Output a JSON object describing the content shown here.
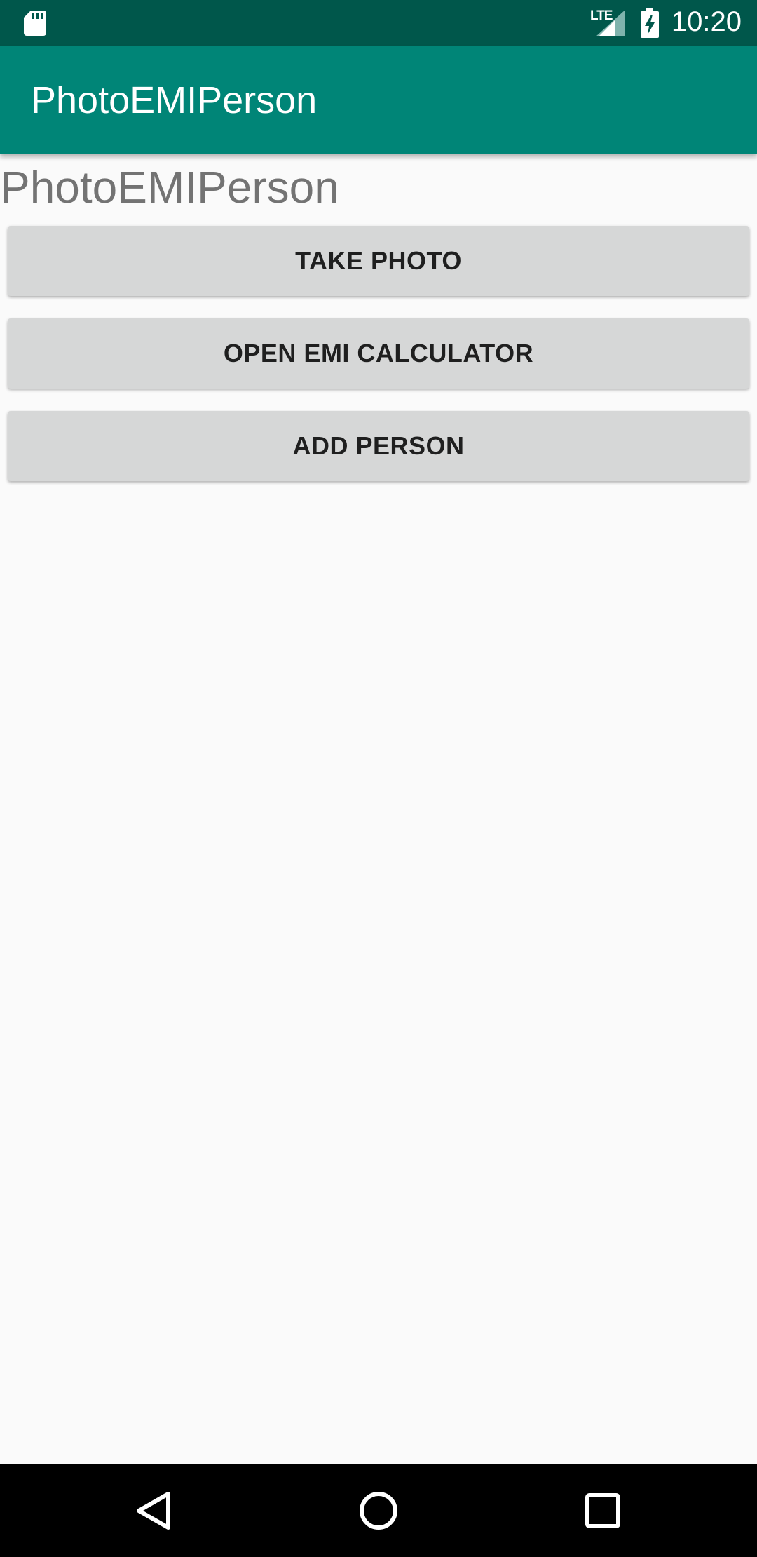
{
  "status_bar": {
    "network_label": "LTE",
    "time": "10:20",
    "icons": [
      "sd-card-icon",
      "signal-icon",
      "battery-charging-icon"
    ]
  },
  "app_bar": {
    "title": "PhotoEMIPerson"
  },
  "main": {
    "heading": "PhotoEMIPerson",
    "buttons": [
      {
        "label": "TAKE PHOTO"
      },
      {
        "label": "OPEN EMI CALCULATOR"
      },
      {
        "label": "ADD PERSON"
      }
    ]
  },
  "nav_bar": {
    "icons": [
      "back-icon",
      "home-icon",
      "recents-icon"
    ]
  },
  "colors": {
    "status_bar": "#00574b",
    "app_bar": "#008577",
    "background": "#fafafa",
    "button": "#d6d7d7",
    "heading_text": "#737373"
  }
}
